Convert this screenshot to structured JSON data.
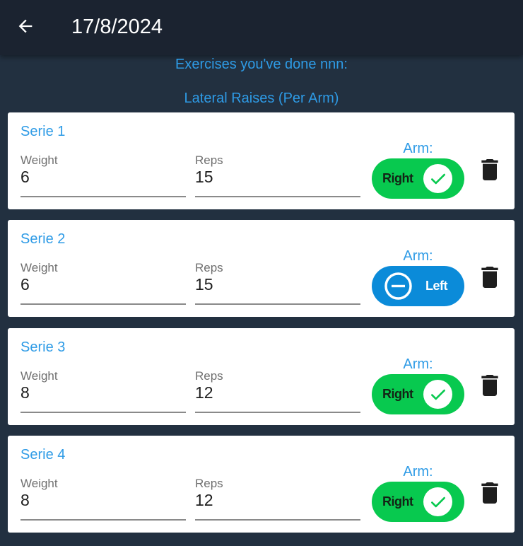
{
  "appbar": {
    "title": "17/8/2024"
  },
  "header": {
    "subtitle": "Exercises you've done nnn:",
    "exercise": "Lateral Raises (Per Arm)"
  },
  "labels": {
    "weight": "Weight",
    "reps": "Reps",
    "arm": "Arm:"
  },
  "series": [
    {
      "title": "Serie 1",
      "weight": "6",
      "reps": "15",
      "arm": "Right"
    },
    {
      "title": "Serie 2",
      "weight": "6",
      "reps": "15",
      "arm": "Left"
    },
    {
      "title": "Serie 3",
      "weight": "8",
      "reps": "12",
      "arm": "Right"
    },
    {
      "title": "Serie 4",
      "weight": "8",
      "reps": "12",
      "arm": "Right"
    }
  ],
  "colors": {
    "accent": "#2e9be6",
    "toggle_right": "#08c94f",
    "toggle_left": "#0b8bd9",
    "background": "#223040",
    "appbar": "#1b2330"
  },
  "icons": {
    "back": "arrow-left-icon",
    "check": "check-icon",
    "minus": "minus-circle-icon",
    "delete": "trash-icon"
  }
}
